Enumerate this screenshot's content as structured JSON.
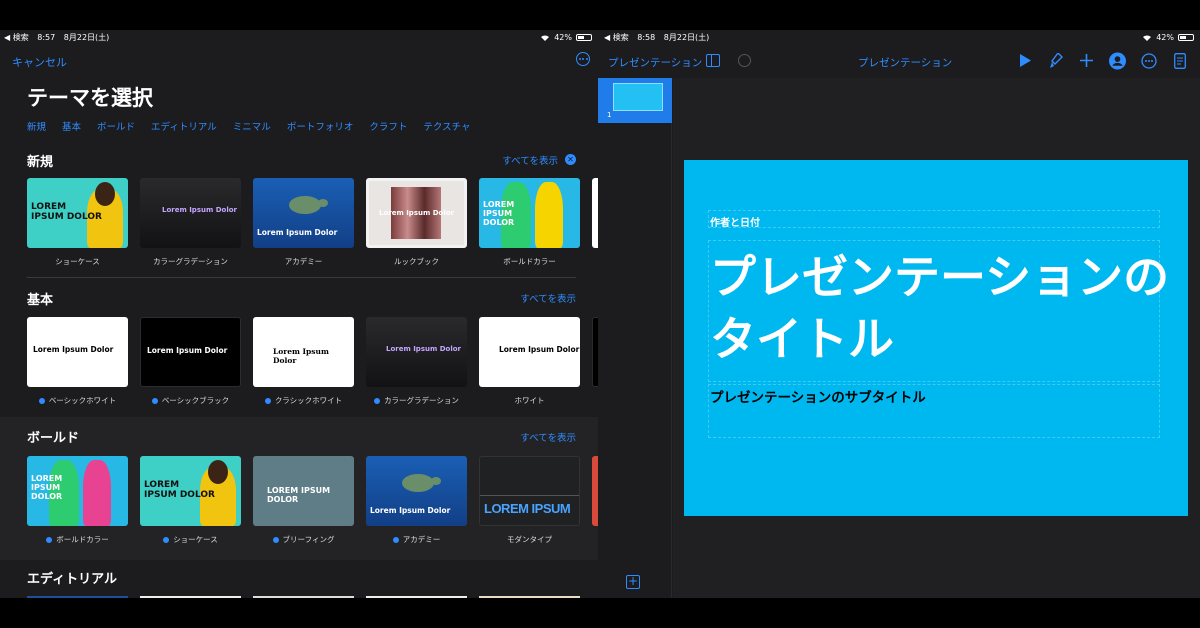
{
  "left": {
    "status": {
      "back": "◀ 検索",
      "time": "8:57",
      "date": "8月22日(土)",
      "battery": "42%"
    },
    "cancel_label": "キャンセル",
    "title": "テーマを選択",
    "categories": [
      "新規",
      "基本",
      "ボールド",
      "エディトリアル",
      "ミニマル",
      "ポートフォリオ",
      "クラフト",
      "テクスチャ"
    ],
    "sections": [
      {
        "title": "新規",
        "see_all": "すべてを表示",
        "themes": [
          {
            "label": "ショーケース",
            "thumb_text": "LOREM\nIPSUM DOLOR"
          },
          {
            "label": "カラーグラデーション",
            "thumb_text": "Lorem Ipsum Dolor"
          },
          {
            "label": "アカデミー",
            "thumb_text": "Lorem Ipsum Dolor"
          },
          {
            "label": "ルックブック",
            "thumb_text": "Lorem Ipsum Dolor"
          },
          {
            "label": "ボールドカラー",
            "thumb_text": "LOREM IPSUM DOLOR"
          }
        ]
      },
      {
        "title": "基本",
        "see_all": "すべてを表示",
        "themes": [
          {
            "label": "ベーシックホワイト",
            "thumb_text": "Lorem Ipsum Dolor"
          },
          {
            "label": "ベーシックブラック",
            "thumb_text": "Lorem Ipsum Dolor"
          },
          {
            "label": "クラシックホワイト",
            "thumb_text": "Lorem Ipsum Dolor"
          },
          {
            "label": "カラーグラデーション",
            "thumb_text": "Lorem Ipsum Dolor"
          },
          {
            "label": "ホワイト",
            "thumb_text": "Lorem Ipsum Dolor"
          }
        ]
      },
      {
        "title": "ボールド",
        "see_all": "すべてを表示",
        "themes": [
          {
            "label": "ボールドカラー",
            "thumb_text": "LOREM IPSUM DOLOR"
          },
          {
            "label": "ショーケース",
            "thumb_text": "LOREM\nIPSUM DOLOR"
          },
          {
            "label": "ブリーフィング",
            "thumb_text": "LOREM IPSUM DOLOR"
          },
          {
            "label": "アカデミー",
            "thumb_text": "Lorem Ipsum Dolor"
          },
          {
            "label": "モダンタイプ",
            "thumb_text": "LOREM IPSUM"
          }
        ]
      },
      {
        "title": "エディトリアル"
      }
    ]
  },
  "right": {
    "status": {
      "back": "◀ 検索",
      "time": "8:58",
      "date": "8月22日(土)",
      "battery": "42%"
    },
    "toolbar": {
      "presentations_label": "プレゼンテーション",
      "doc_title": "プレゼンテーション"
    },
    "navigator": {
      "slide_number": "1"
    },
    "slide": {
      "author_date": "作者と日付",
      "title": "プレゼンテーションのタイトル",
      "subtitle": "プレゼンテーションのサブタイトル"
    }
  },
  "colors": {
    "accent": "#2f8cff",
    "slide_bg": "#00b8f0",
    "panel_bg": "#1c1c1e"
  }
}
